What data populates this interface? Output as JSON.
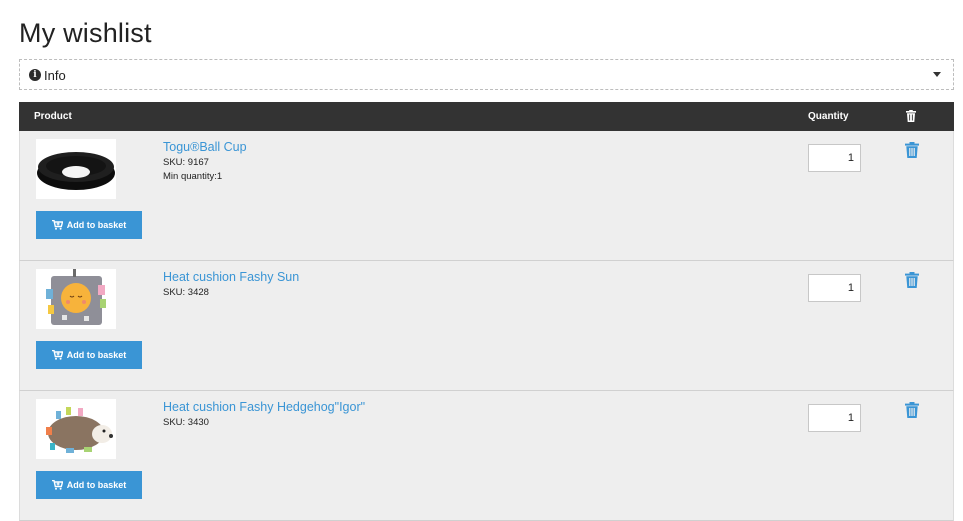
{
  "page": {
    "title": "My wishlist"
  },
  "info": {
    "label": "Info"
  },
  "table": {
    "headers": {
      "product": "Product",
      "quantity": "Quantity"
    },
    "colors": {
      "header_bg": "#333333",
      "accent": "#3a95d5",
      "row_bg": "#eeeeee"
    }
  },
  "items": [
    {
      "name": "Togu®Ball Cup",
      "sku": "SKU: 9167",
      "min_qty": "Min quantity:1",
      "quantity": "1",
      "basket_label": "Add to basket"
    },
    {
      "name": "Heat cushion Fashy Sun",
      "sku": "SKU: 3428",
      "quantity": "1",
      "basket_label": "Add to basket"
    },
    {
      "name": "Heat cushion Fashy Hedgehog\"Igor\"",
      "sku": "SKU: 3430",
      "quantity": "1",
      "basket_label": "Add to basket"
    }
  ]
}
